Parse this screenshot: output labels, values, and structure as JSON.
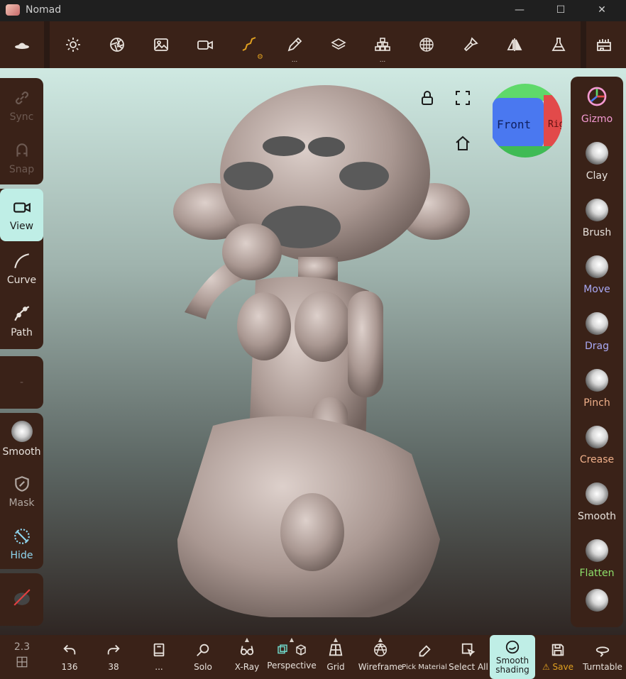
{
  "window": {
    "title": "Nomad",
    "minimize": "—",
    "maximize": "☐",
    "close": "✕"
  },
  "toolbar": {
    "items": [
      "logo",
      "sun",
      "aperture",
      "image",
      "camera",
      "curve",
      "pen",
      "layers",
      "stack",
      "sphere",
      "brush",
      "mirror",
      "flask",
      "factory"
    ]
  },
  "left_panel": {
    "sync": "Sync",
    "snap": "Snap",
    "view": "View",
    "curve": "Curve",
    "path": "Path",
    "empty": "-",
    "smooth": "Smooth",
    "mask": "Mask",
    "hide": "Hide"
  },
  "right_panel": {
    "gizmo": "Gizmo",
    "clay": "Clay",
    "brush": "Brush",
    "move": "Move",
    "drag": "Drag",
    "pinch": "Pinch",
    "crease": "Crease",
    "smooth": "Smooth",
    "flatten": "Flatten"
  },
  "gizmo_cube": {
    "front": "Front",
    "right": "Rig"
  },
  "bottom_bar": {
    "version": "2.3",
    "undo_count": "136",
    "redo_count": "38",
    "more": "...",
    "solo": "Solo",
    "xray": "X-Ray",
    "perspective": "Perspective",
    "grid": "Grid",
    "wireframe": "Wireframe",
    "pick_material": "Pick Material",
    "select_all": "Select All",
    "smooth_shading_1": "Smooth",
    "smooth_shading_2": "shading",
    "save": "Save",
    "turntable": "Turntable"
  },
  "colors": {
    "panel": "#3a2218",
    "active": "#bfeee6",
    "accent_orange": "#e0a020",
    "move": "#a9a9f4",
    "drag": "#a9a9f4",
    "pinch": "#f0b08a",
    "crease": "#f0b08a",
    "flatten": "#8ee06a",
    "gizmo": "#f49ad2"
  }
}
